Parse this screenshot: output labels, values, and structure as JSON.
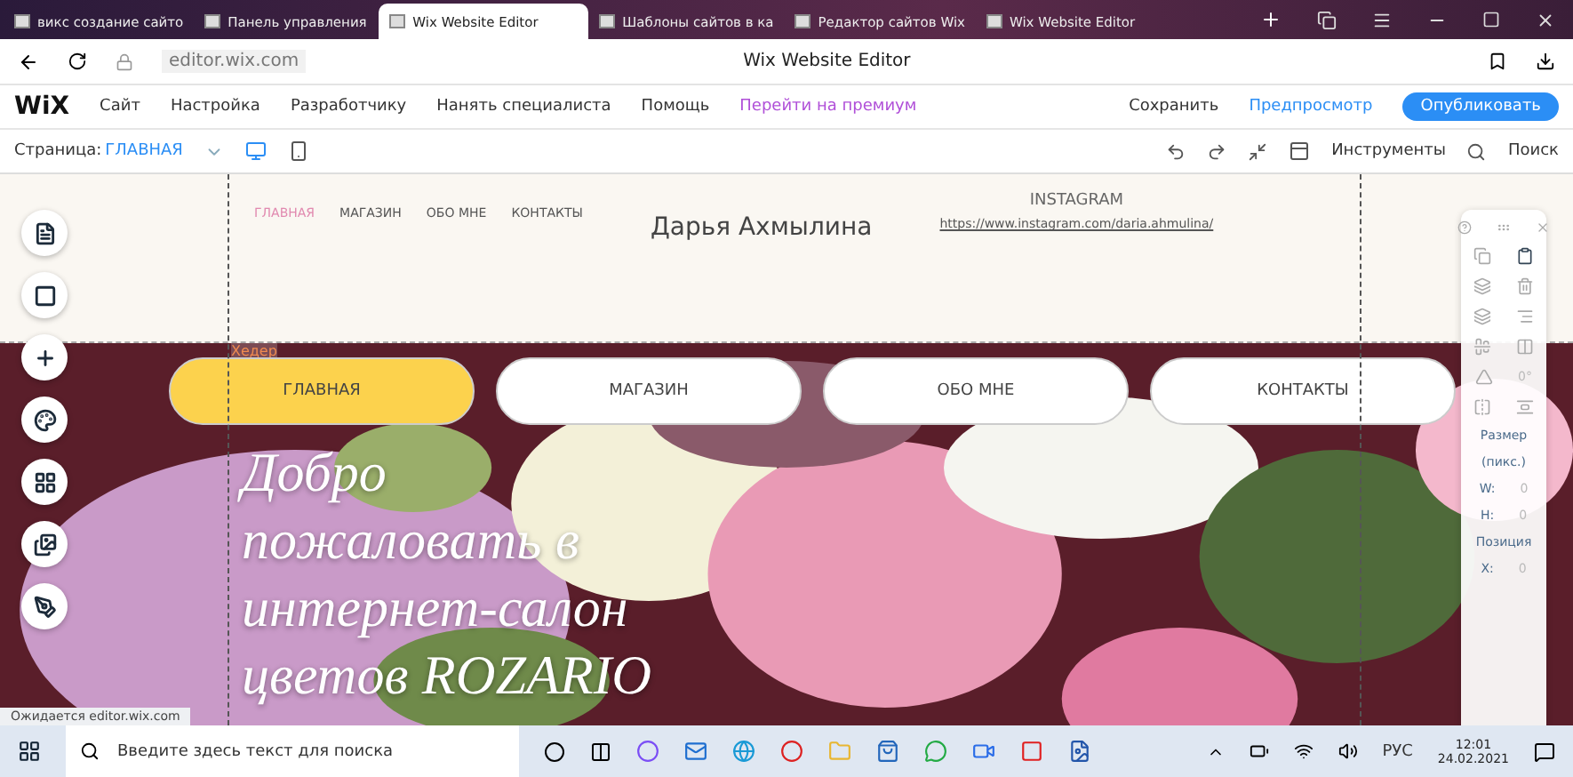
{
  "browser": {
    "tabs": [
      {
        "label": "викс создание сайто",
        "selected": false
      },
      {
        "label": "Панель управления",
        "selected": false
      },
      {
        "label": "Wix Website Editor",
        "selected": true
      },
      {
        "label": "Шаблоны сайтов в ка",
        "selected": false
      },
      {
        "label": "Редактор сайтов Wix",
        "selected": false
      },
      {
        "label": "Wix Website Editor",
        "selected": false
      }
    ],
    "address": "editor.wix.com",
    "page_title": "Wix Website Editor"
  },
  "wix_menu": {
    "logo": "WiX",
    "items": [
      "Сайт",
      "Настройка",
      "Разработчику",
      "Нанять специалиста",
      "Помощь"
    ],
    "premium": "Перейти на премиум",
    "save": "Сохранить",
    "preview": "Предпросмотр",
    "publish": "Опубликовать"
  },
  "toolbar": {
    "page_label": "Страница:",
    "page_value": "ГЛАВНАЯ",
    "tools": "Инструменты",
    "search": "Поиск"
  },
  "site": {
    "nav": [
      {
        "label": "ГЛАВНАЯ",
        "selected": true
      },
      {
        "label": "МАГАЗИН",
        "selected": false
      },
      {
        "label": "ОБО МНЕ",
        "selected": false
      },
      {
        "label": "КОНТАКТЫ",
        "selected": false
      }
    ],
    "name": "Дарья Ахмылина",
    "instagram_title": "INSTAGRAM",
    "instagram_url": "https://www.instagram.com/daria.ahmulina/",
    "section_label": "Хедер",
    "buttons": [
      {
        "label": "ГЛАВНАЯ",
        "selected": true
      },
      {
        "label": "МАГАЗИН",
        "selected": false
      },
      {
        "label": "ОБО МНЕ",
        "selected": false
      },
      {
        "label": "КОНТАКТЫ",
        "selected": false
      }
    ],
    "headline": [
      "Добро",
      "пожаловать в",
      "интернет-салон",
      "цветов ROZARIO"
    ]
  },
  "panel": {
    "rotation": "0°",
    "size_title": "Размер",
    "size_unit": "(пикс.)",
    "w_label": "W:",
    "w_value": "0",
    "h_label": "H:",
    "h_value": "0",
    "position_title": "Позиция",
    "x_label": "X:",
    "x_value": "0"
  },
  "status": "Ожидается editor.wix.com",
  "taskbar": {
    "search_placeholder": "Введите здесь текст для поиска",
    "lang": "РУС",
    "time": "12:01",
    "date": "24.02.2021"
  }
}
